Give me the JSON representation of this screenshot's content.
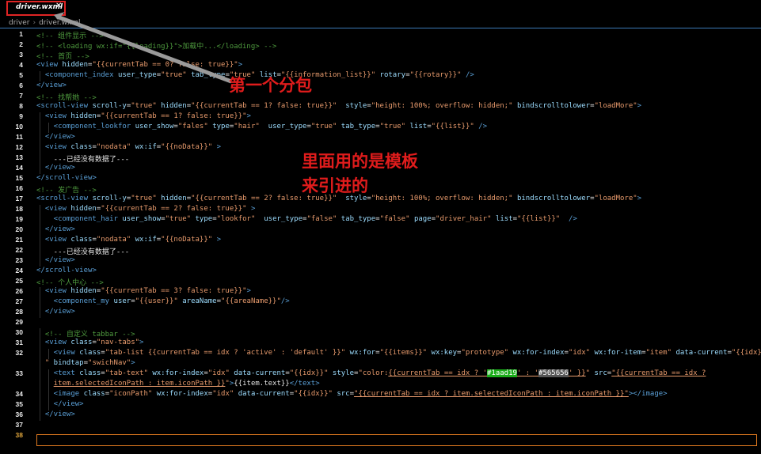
{
  "tab": {
    "filename": "driver.wxml",
    "close_icon": "✕"
  },
  "breadcrumb": [
    "driver",
    "driver.wxml"
  ],
  "annotations": {
    "subpackage": "第一个分包",
    "template_line1": "里面用的是模板",
    "template_line2": "来引进的"
  },
  "colors": {
    "green_swatch": "#1aad19",
    "gray_swatch": "#565656",
    "annotation": "#e01c1c",
    "highlight_box": "#e02424"
  },
  "current_line": 38,
  "lines": [
    {
      "n": 1,
      "indent": 0,
      "tokens": [
        [
          "c",
          "<!-- 组件显示 -->"
        ]
      ]
    },
    {
      "n": 2,
      "indent": 0,
      "tokens": [
        [
          "c",
          "<!-- <loading wx:if=\"{{loading}}\">加载中...</loading> -->"
        ]
      ]
    },
    {
      "n": 3,
      "indent": 0,
      "tokens": [
        [
          "c",
          "<!-- 首页 -->"
        ]
      ]
    },
    {
      "n": 4,
      "indent": 0,
      "tokens": [
        [
          "t",
          "<view "
        ],
        [
          "a",
          "hidden"
        ],
        [
          "w",
          "="
        ],
        [
          "s",
          "\"{{currentTab == 0? false: true}}\""
        ],
        [
          "t",
          ">"
        ]
      ]
    },
    {
      "n": 5,
      "indent": 1,
      "tokens": [
        [
          "t",
          "<component_index "
        ],
        [
          "a",
          "user_type"
        ],
        [
          "w",
          "="
        ],
        [
          "s",
          "\"true\" "
        ],
        [
          "a",
          "tab_type"
        ],
        [
          "w",
          "="
        ],
        [
          "s",
          "\"true\" "
        ],
        [
          "a",
          "list"
        ],
        [
          "w",
          "="
        ],
        [
          "s",
          "\"{{information_list}}\" "
        ],
        [
          "a",
          "rotary"
        ],
        [
          "w",
          "="
        ],
        [
          "s",
          "\"{{rotary}}\" "
        ],
        [
          "t",
          "/>"
        ]
      ]
    },
    {
      "n": 6,
      "indent": 0,
      "tokens": [
        [
          "t",
          "</view>"
        ]
      ]
    },
    {
      "n": 7,
      "indent": 0,
      "tokens": [
        [
          "c",
          "<!-- 找帮她 -->"
        ]
      ]
    },
    {
      "n": 8,
      "indent": 0,
      "tokens": [
        [
          "t",
          "<scroll-view "
        ],
        [
          "a",
          "scroll-y"
        ],
        [
          "w",
          "="
        ],
        [
          "s",
          "\"true\" "
        ],
        [
          "a",
          "hidden"
        ],
        [
          "w",
          "="
        ],
        [
          "s",
          "\"{{currentTab == 1? false: true}}\"  "
        ],
        [
          "a",
          "style"
        ],
        [
          "w",
          "="
        ],
        [
          "s",
          "\"height: 100%; overflow: hidden;\" "
        ],
        [
          "a",
          "bindscrolltolower"
        ],
        [
          "w",
          "="
        ],
        [
          "s",
          "\"loadMore\""
        ],
        [
          "t",
          ">"
        ]
      ]
    },
    {
      "n": 9,
      "indent": 1,
      "tokens": [
        [
          "t",
          "<view "
        ],
        [
          "a",
          "hidden"
        ],
        [
          "w",
          "="
        ],
        [
          "s",
          "\"{{currentTab == 1? false: true}}\""
        ],
        [
          "t",
          ">"
        ]
      ]
    },
    {
      "n": 10,
      "indent": 2,
      "tokens": [
        [
          "t",
          "<component_lookfor "
        ],
        [
          "a",
          "user_show"
        ],
        [
          "w",
          "="
        ],
        [
          "s",
          "\"fales\" "
        ],
        [
          "a",
          "type"
        ],
        [
          "w",
          "="
        ],
        [
          "s",
          "\"hair\"  "
        ],
        [
          "a",
          "user_type"
        ],
        [
          "w",
          "="
        ],
        [
          "s",
          "\"true\" "
        ],
        [
          "a",
          "tab_type"
        ],
        [
          "w",
          "="
        ],
        [
          "s",
          "\"true\" "
        ],
        [
          "a",
          "list"
        ],
        [
          "w",
          "="
        ],
        [
          "s",
          "\"{{list}}\" "
        ],
        [
          "t",
          "/>"
        ]
      ]
    },
    {
      "n": 11,
      "indent": 1,
      "tokens": [
        [
          "t",
          "</view>"
        ]
      ]
    },
    {
      "n": 12,
      "indent": 1,
      "tokens": [
        [
          "t",
          "<view "
        ],
        [
          "a",
          "class"
        ],
        [
          "w",
          "="
        ],
        [
          "s",
          "\"nodata\" "
        ],
        [
          "a",
          "wx:if"
        ],
        [
          "w",
          "="
        ],
        [
          "s",
          "\"{{noData}}\" "
        ],
        [
          "t",
          ">"
        ]
      ]
    },
    {
      "n": 13,
      "indent": 1,
      "tokens": [
        [
          "w",
          "  ---已经没有数据了---"
        ]
      ]
    },
    {
      "n": 14,
      "indent": 1,
      "tokens": [
        [
          "t",
          "</view>"
        ]
      ]
    },
    {
      "n": 15,
      "indent": 0,
      "tokens": [
        [
          "t",
          "</scroll-view>"
        ]
      ]
    },
    {
      "n": 16,
      "indent": 0,
      "tokens": [
        [
          "c",
          "<!-- 发广告 -->"
        ]
      ]
    },
    {
      "n": 17,
      "indent": 0,
      "tokens": [
        [
          "t",
          "<scroll-view "
        ],
        [
          "a",
          "scroll-y"
        ],
        [
          "w",
          "="
        ],
        [
          "s",
          "\"true\" "
        ],
        [
          "a",
          "hidden"
        ],
        [
          "w",
          "="
        ],
        [
          "s",
          "\"{{currentTab == 2? false: true}}\"  "
        ],
        [
          "a",
          "style"
        ],
        [
          "w",
          "="
        ],
        [
          "s",
          "\"height: 100%; overflow: hidden;\" "
        ],
        [
          "a",
          "bindscrolltolower"
        ],
        [
          "w",
          "="
        ],
        [
          "s",
          "\"loadMore\""
        ],
        [
          "t",
          ">"
        ]
      ]
    },
    {
      "n": 18,
      "indent": 1,
      "tokens": [
        [
          "t",
          "<view "
        ],
        [
          "a",
          "hidden"
        ],
        [
          "w",
          "="
        ],
        [
          "s",
          "\"{{currentTab == 2? false: true}}\" "
        ],
        [
          "t",
          ">"
        ]
      ]
    },
    {
      "n": 19,
      "indent": 1,
      "tokens": [
        [
          "t",
          "  <component_hair "
        ],
        [
          "a",
          "user_show"
        ],
        [
          "w",
          "="
        ],
        [
          "s",
          "\"true\" "
        ],
        [
          "a",
          "type"
        ],
        [
          "w",
          "="
        ],
        [
          "s",
          "\"lookfor\"  "
        ],
        [
          "a",
          "user_type"
        ],
        [
          "w",
          "="
        ],
        [
          "s",
          "\"false\" "
        ],
        [
          "a",
          "tab_type"
        ],
        [
          "w",
          "="
        ],
        [
          "s",
          "\"false\" "
        ],
        [
          "a",
          "page"
        ],
        [
          "w",
          "="
        ],
        [
          "s",
          "\"driver_hair\" "
        ],
        [
          "a",
          "list"
        ],
        [
          "w",
          "="
        ],
        [
          "s",
          "\"{{list}}\"  "
        ],
        [
          "t",
          "/>"
        ]
      ]
    },
    {
      "n": 20,
      "indent": 1,
      "tokens": [
        [
          "t",
          "</view>"
        ]
      ]
    },
    {
      "n": 21,
      "indent": 1,
      "tokens": [
        [
          "t",
          "<view "
        ],
        [
          "a",
          "class"
        ],
        [
          "w",
          "="
        ],
        [
          "s",
          "\"nodata\" "
        ],
        [
          "a",
          "wx:if"
        ],
        [
          "w",
          "="
        ],
        [
          "s",
          "\"{{noData}}\" "
        ],
        [
          "t",
          ">"
        ]
      ]
    },
    {
      "n": 22,
      "indent": 1,
      "tokens": [
        [
          "w",
          "  ---已经没有数据了---"
        ]
      ]
    },
    {
      "n": 23,
      "indent": 1,
      "tokens": [
        [
          "t",
          "</view>"
        ]
      ]
    },
    {
      "n": 24,
      "indent": 0,
      "tokens": [
        [
          "t",
          "</scroll-view>"
        ]
      ]
    },
    {
      "n": 25,
      "indent": 0,
      "tokens": [
        [
          "c",
          "<!-- 个人中心 -->"
        ]
      ]
    },
    {
      "n": 26,
      "indent": 1,
      "tokens": [
        [
          "t",
          "<view "
        ],
        [
          "a",
          "hidden"
        ],
        [
          "w",
          "="
        ],
        [
          "s",
          "\"{{currentTab == 3? false: true}}\""
        ],
        [
          "t",
          ">"
        ]
      ]
    },
    {
      "n": 27,
      "indent": 1,
      "tokens": [
        [
          "t",
          "  <component_my "
        ],
        [
          "a",
          "user"
        ],
        [
          "w",
          "="
        ],
        [
          "s",
          "\"{{user}}\" "
        ],
        [
          "a",
          "areaName"
        ],
        [
          "w",
          "="
        ],
        [
          "s",
          "\"{{areaName}}\""
        ],
        [
          "t",
          "/>"
        ]
      ]
    },
    {
      "n": 28,
      "indent": 1,
      "tokens": [
        [
          "t",
          "</view>"
        ]
      ]
    },
    {
      "n": 29,
      "indent": 0,
      "tokens": []
    },
    {
      "n": 30,
      "indent": 1,
      "tokens": [
        [
          "c",
          "<!-- 自定义 tabbar -->"
        ]
      ]
    },
    {
      "n": 31,
      "indent": 1,
      "tokens": [
        [
          "t",
          "<view "
        ],
        [
          "a",
          "class"
        ],
        [
          "w",
          "="
        ],
        [
          "s",
          "\"nav-tabs\""
        ],
        [
          "t",
          ">"
        ]
      ]
    },
    {
      "n": 32,
      "indent": 2,
      "tokens": [
        [
          "t",
          "<view "
        ],
        [
          "a",
          "class"
        ],
        [
          "w",
          "="
        ],
        [
          "s",
          "\"tab-list {{currentTab == idx ? 'active' : 'default' }}\" "
        ],
        [
          "a",
          "wx:for"
        ],
        [
          "w",
          "="
        ],
        [
          "s",
          "\"{{items}}\" "
        ],
        [
          "a",
          "wx:key"
        ],
        [
          "w",
          "="
        ],
        [
          "s",
          "\"prototype\" "
        ],
        [
          "a",
          "wx:for-index"
        ],
        [
          "w",
          "="
        ],
        [
          "s",
          "\"idx\" "
        ],
        [
          "a",
          "wx:for-item"
        ],
        [
          "w",
          "="
        ],
        [
          "s",
          "\"item\" "
        ],
        [
          "a",
          "data-current"
        ],
        [
          "w",
          "="
        ],
        [
          "s",
          "\"{{idx}}\""
        ]
      ]
    },
    {
      "n": null,
      "indent": 1,
      "tokens": [
        [
          "s",
          "\" "
        ],
        [
          "a",
          "bindtap"
        ],
        [
          "w",
          "="
        ],
        [
          "s",
          "\"swichNav\""
        ],
        [
          "t",
          ">"
        ]
      ]
    },
    {
      "n": 33,
      "indent": 2,
      "tokens": [
        [
          "t",
          "<text "
        ],
        [
          "a",
          "class"
        ],
        [
          "w",
          "="
        ],
        [
          "s",
          "\"tab-text\" "
        ],
        [
          "a",
          "wx:for-index"
        ],
        [
          "w",
          "="
        ],
        [
          "s",
          "\"idx\" "
        ],
        [
          "a",
          "data-current"
        ],
        [
          "w",
          "="
        ],
        [
          "s",
          "\"{{idx}}\" "
        ],
        [
          "a",
          "style"
        ],
        [
          "w",
          "="
        ],
        [
          "s",
          "\"color:"
        ],
        [
          "su",
          "{{currentTab == idx ? '"
        ],
        [
          "g",
          "#1aad19"
        ],
        [
          "su",
          "' : '"
        ],
        [
          "k",
          "#565656"
        ],
        [
          "su",
          "' }}"
        ],
        [
          "s",
          "\" "
        ],
        [
          "a",
          "src"
        ],
        [
          "w",
          "="
        ],
        [
          "su",
          "\"{{currentTab == idx ?"
        ]
      ]
    },
    {
      "n": null,
      "indent": 2,
      "tokens": [
        [
          "su",
          "item.selectedIconPath : item.iconPath }}"
        ],
        [
          "s",
          "\""
        ],
        [
          "t",
          ">"
        ],
        [
          "w",
          "{{item.text}}"
        ],
        [
          "t",
          "</text>"
        ]
      ]
    },
    {
      "n": 34,
      "indent": 2,
      "tokens": [
        [
          "t",
          "<image "
        ],
        [
          "a",
          "class"
        ],
        [
          "w",
          "="
        ],
        [
          "s",
          "\"iconPath\" "
        ],
        [
          "a",
          "wx:for-index"
        ],
        [
          "w",
          "="
        ],
        [
          "s",
          "\"idx\" "
        ],
        [
          "a",
          "data-current"
        ],
        [
          "w",
          "="
        ],
        [
          "s",
          "\"{{idx}}\" "
        ],
        [
          "a",
          "src"
        ],
        [
          "w",
          "="
        ],
        [
          "su",
          "\"{{currentTab == idx ? item.selectedIconPath : item.iconPath }}\""
        ],
        [
          "t",
          "></image>"
        ]
      ]
    },
    {
      "n": 35,
      "indent": 2,
      "tokens": [
        [
          "t",
          "</view>"
        ]
      ]
    },
    {
      "n": 36,
      "indent": 1,
      "tokens": [
        [
          "t",
          "</view>"
        ]
      ]
    },
    {
      "n": 37,
      "indent": 0,
      "tokens": []
    },
    {
      "n": 38,
      "indent": 0,
      "tokens": []
    }
  ]
}
